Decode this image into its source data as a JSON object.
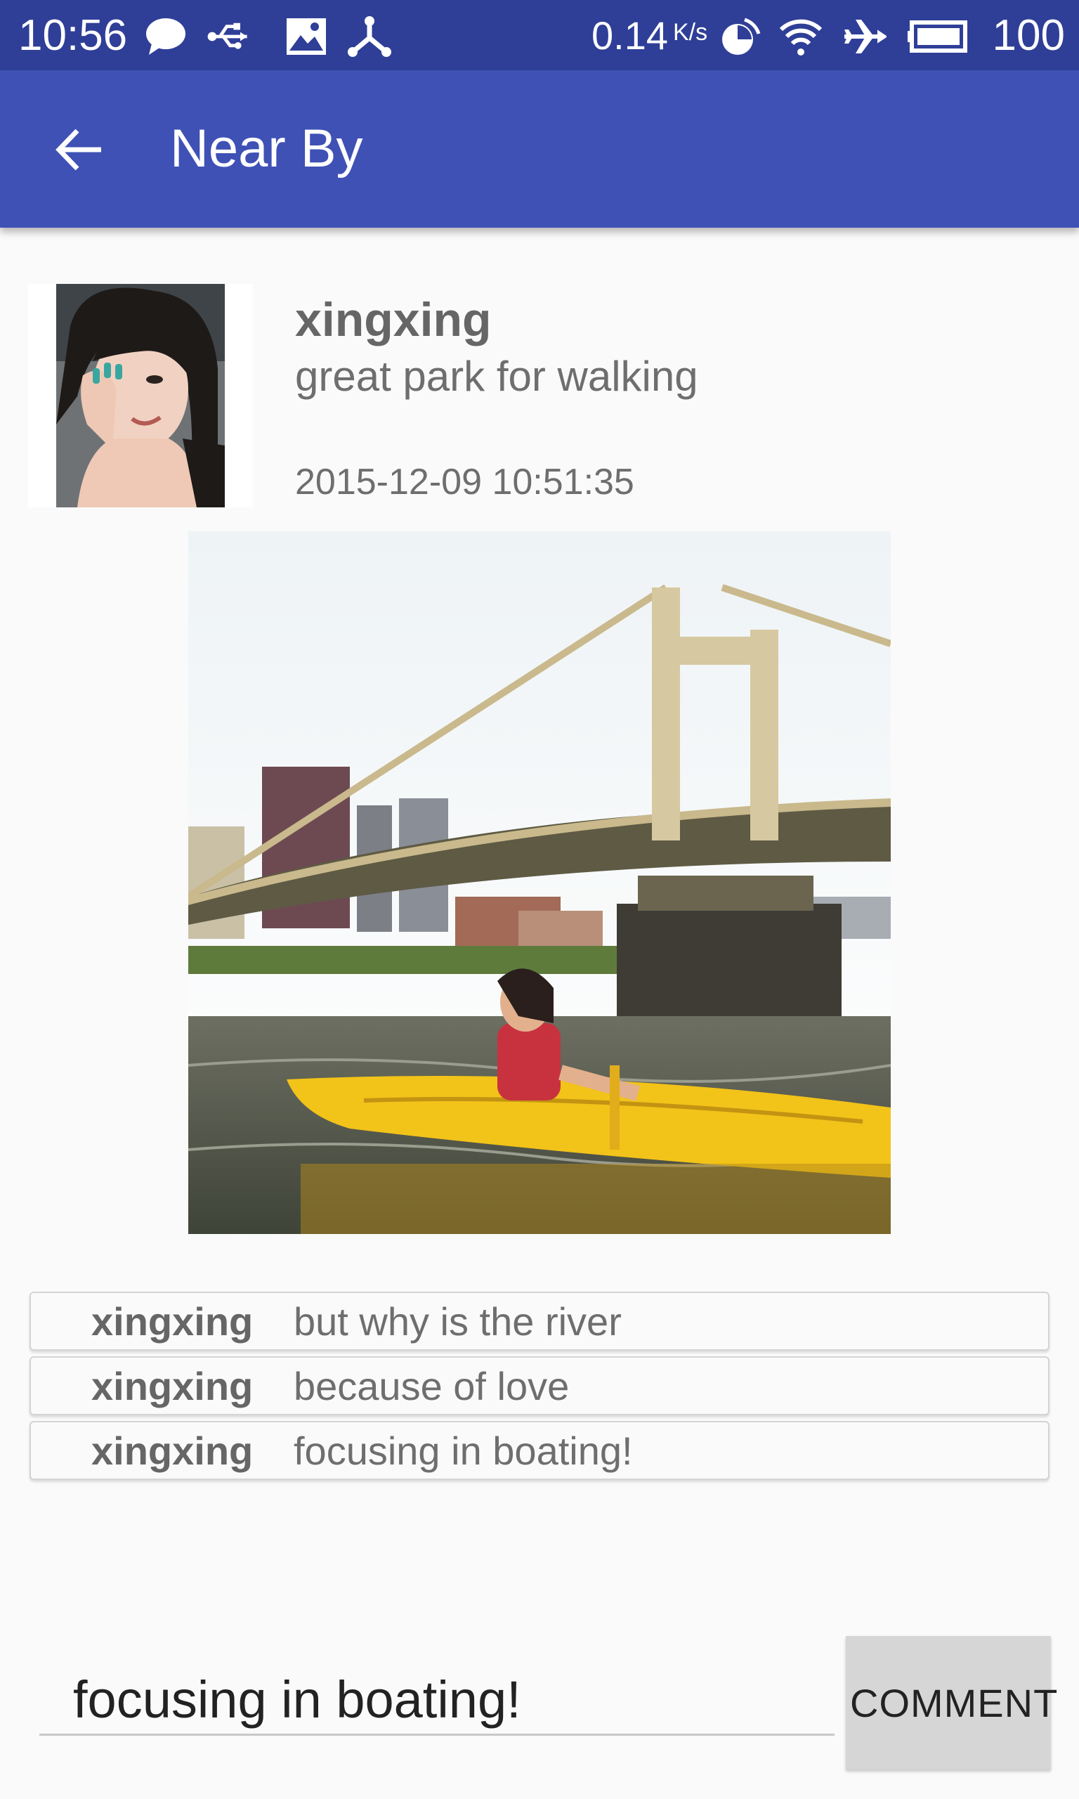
{
  "status_bar": {
    "time": "10:56",
    "net_speed": "0.14",
    "net_speed_unit": "K/s",
    "battery": "100",
    "icons": [
      "chat-icon",
      "usb-icon",
      "image-icon",
      "share-icon",
      "data-saver-icon",
      "wifi-icon",
      "airplane-icon",
      "battery-icon"
    ]
  },
  "app_bar": {
    "title": "Near By",
    "back_icon": "arrow-back-icon",
    "color": "#3f51b5"
  },
  "post": {
    "username": "xingxing",
    "text": "great park for walking",
    "timestamp": "2015-12-09 10:51:35"
  },
  "comments": [
    {
      "user": "xingxing",
      "text": "but why is the river"
    },
    {
      "user": "xingxing",
      "text": "because of love"
    },
    {
      "user": "xingxing",
      "text": "focusing in boating!"
    }
  ],
  "comment_input": {
    "value": "focusing in boating!"
  },
  "comment_button": {
    "label": "COMMENT"
  },
  "colors": {
    "status_bar": "#2f3f97",
    "accent": "#3f51b5",
    "background": "#fafafa"
  }
}
